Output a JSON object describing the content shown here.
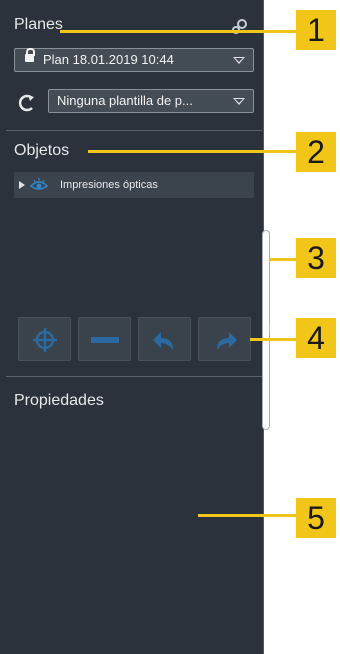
{
  "planes": {
    "heading": "Planes",
    "plan_combo": "Plan 18.01.2019 10:44",
    "template_combo": "Ninguna plantilla de p..."
  },
  "objetos": {
    "heading": "Objetos",
    "tree_items": [
      {
        "label": "Impresiones ópticas"
      }
    ]
  },
  "propiedades": {
    "heading": "Propiedades"
  },
  "toolbar": {
    "buttons": [
      "center-object",
      "collapse-all",
      "undo",
      "redo"
    ]
  },
  "callouts": [
    "1",
    "2",
    "3",
    "4",
    "5"
  ],
  "colors": {
    "panel_bg": "#2b323b",
    "callout": "#f2c618",
    "accent_blue": "#2f86c8"
  }
}
